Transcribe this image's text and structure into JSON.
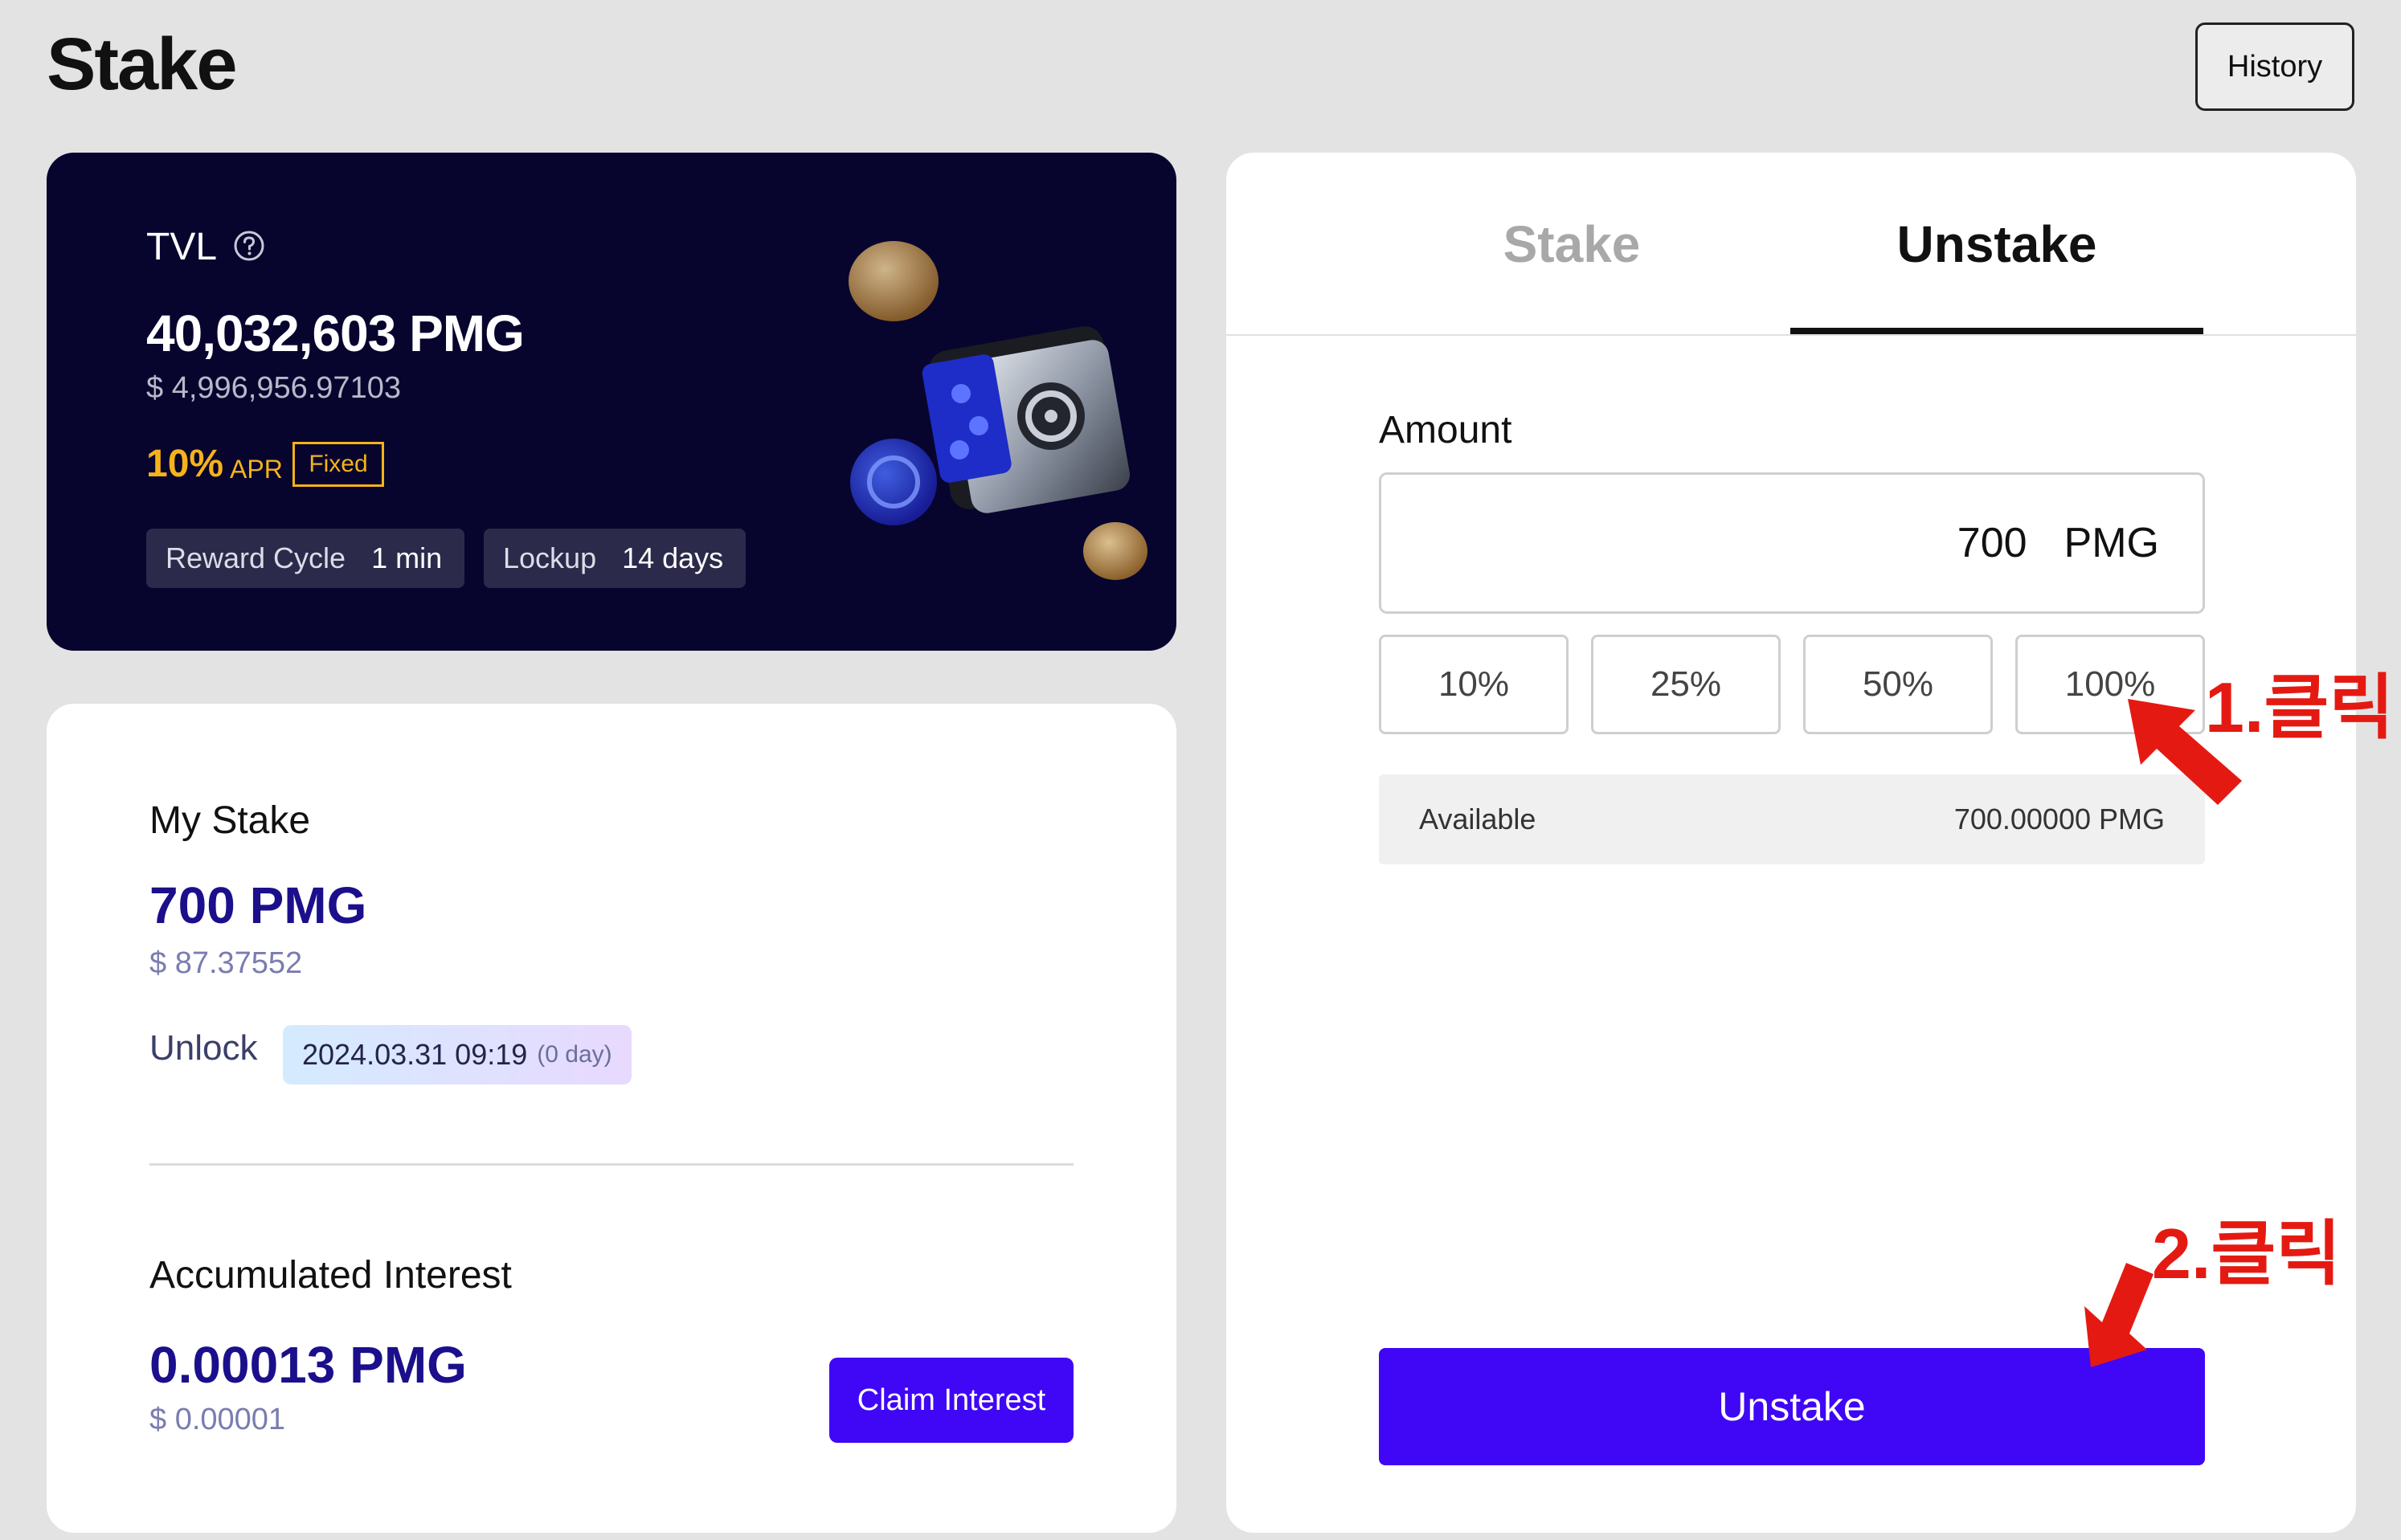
{
  "header": {
    "title": "Stake",
    "history_label": "History"
  },
  "tvl": {
    "label": "TVL",
    "value": "40,032,603 PMG",
    "usd": "$ 4,996,956.97103",
    "apr_value": "10%",
    "apr_label": "APR",
    "fixed_label": "Fixed",
    "reward_cycle_label": "Reward Cycle",
    "reward_cycle_value": "1 min",
    "lockup_label": "Lockup",
    "lockup_value": "14 days"
  },
  "my_stake": {
    "label": "My Stake",
    "value": "700 PMG",
    "usd": "$ 87.37552",
    "unlock_label": "Unlock",
    "unlock_date": "2024.03.31 09:19",
    "unlock_days": "(0 day)"
  },
  "interest": {
    "label": "Accumulated Interest",
    "value": "0.00013 PMG",
    "usd": "$ 0.00001",
    "claim_label": "Claim Interest"
  },
  "panel": {
    "tabs": [
      {
        "label": "Stake",
        "active": false
      },
      {
        "label": "Unstake",
        "active": true
      }
    ],
    "amount_label": "Amount",
    "amount_value": "700",
    "amount_unit": "PMG",
    "percent_options": [
      "10%",
      "25%",
      "50%",
      "100%"
    ],
    "available_label": "Available",
    "available_value": "700.00000  PMG",
    "submit_label": "Unstake"
  },
  "annotations": {
    "step1": "1.클릭",
    "step2": "2.클릭"
  },
  "colors": {
    "background": "#e3e3e3",
    "tvl_card": "#07052e",
    "accent_purple": "#3f07f5",
    "apr_yellow": "#f5b21a",
    "stake_value_navy": "#1b0f8c",
    "annotation_red": "#e41a12"
  }
}
